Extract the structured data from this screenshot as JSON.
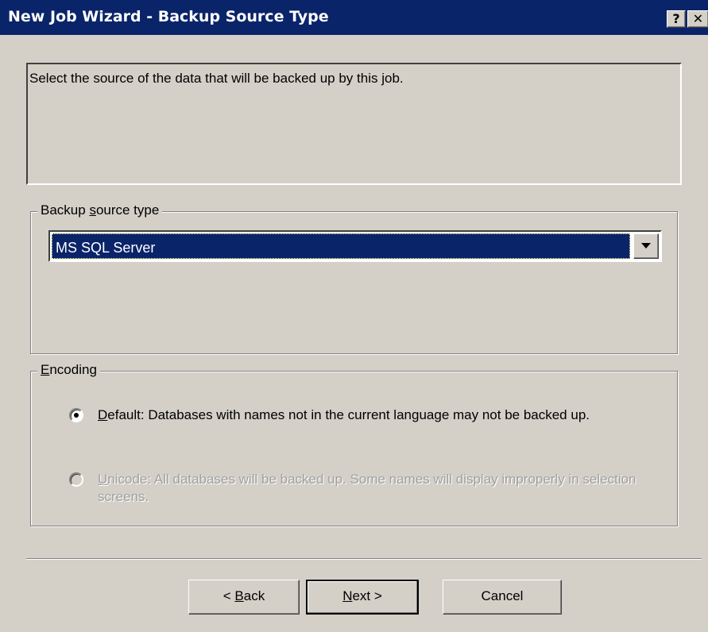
{
  "window": {
    "title": "New Job Wizard - Backup Source Type",
    "help_glyph": "?",
    "close_glyph": "✕"
  },
  "description": "Select the source of the data that will be backed up by this job.",
  "source_group": {
    "legend_pre": "Backup ",
    "legend_underlined": "s",
    "legend_post": "ource type",
    "selected_value": "MS SQL Server"
  },
  "encoding_group": {
    "legend_underlined": "E",
    "legend_post": "ncoding",
    "options": [
      {
        "underlined": "D",
        "label": "efault: Databases with names not in the current language may not be backed up.",
        "selected": true,
        "enabled": true
      },
      {
        "underlined": "U",
        "label": "nicode: All databases will be backed up. Some names will display improperly in selection screens.",
        "selected": false,
        "enabled": false
      }
    ]
  },
  "buttons": {
    "back_pre": "< ",
    "back_underlined": "B",
    "back_post": "ack",
    "next_underlined": "N",
    "next_post": "ext >",
    "cancel": "Cancel"
  },
  "colors": {
    "titlebar": "#0a246a",
    "face": "#d4d0c8",
    "selection": "#0a246a",
    "disabled_text": "#a0a0a0"
  }
}
